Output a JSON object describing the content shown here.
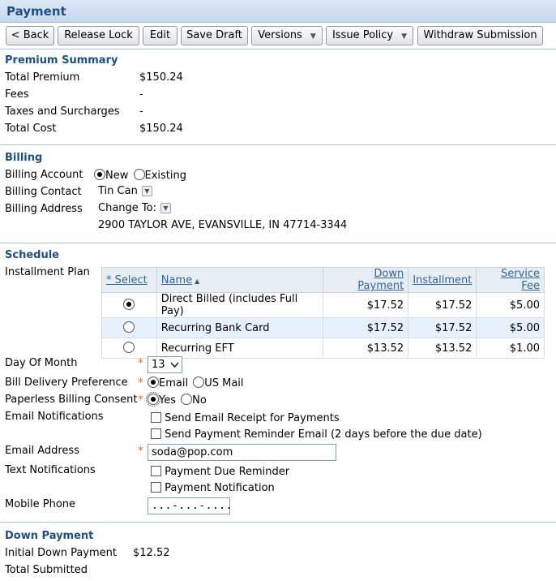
{
  "page": {
    "title": "Payment"
  },
  "toolbar": {
    "back": "< Back",
    "release_lock": "Release Lock",
    "edit": "Edit",
    "save_draft": "Save Draft",
    "versions": "Versions",
    "issue_policy": "Issue Policy",
    "withdraw": "Withdraw Submission",
    "caret": "▼"
  },
  "premium": {
    "heading": "Premium Summary",
    "rows": [
      {
        "label": "Total Premium",
        "value": "$150.24"
      },
      {
        "label": "Fees",
        "value": "-"
      },
      {
        "label": "Taxes and Surcharges",
        "value": "-"
      },
      {
        "label": "Total Cost",
        "value": "$150.24"
      }
    ]
  },
  "billing": {
    "heading": "Billing",
    "account_label": "Billing Account",
    "account_options": [
      "New",
      "Existing"
    ],
    "account_selected": "New",
    "contact_label": "Billing Contact",
    "contact_value": "Tin Can",
    "address_label": "Billing Address",
    "address_change": "Change To:",
    "address_value": "2900 TAYLOR AVE, EVANSVILLE, IN 47714-3344"
  },
  "schedule": {
    "heading": "Schedule",
    "installment_label": "Installment Plan",
    "columns": [
      "* Select",
      "Name",
      "Down Payment",
      "Installment",
      "Service Fee"
    ],
    "sort_indicator": "▲",
    "rows": [
      {
        "name": "Direct Billed (includes Full Pay)",
        "down": "$17.52",
        "installment": "$17.52",
        "fee": "$5.00",
        "selected": true
      },
      {
        "name": "Recurring Bank Card",
        "down": "$17.52",
        "installment": "$17.52",
        "fee": "$5.00",
        "selected": false
      },
      {
        "name": "Recurring EFT",
        "down": "$13.52",
        "installment": "$13.52",
        "fee": "$1.00",
        "selected": false
      }
    ],
    "day_label": "Day Of Month",
    "day_value": "13",
    "delivery_label": "Bill Delivery Preference",
    "delivery_options": [
      "Email",
      "US Mail"
    ],
    "paperless_label": "Paperless Billing Consent",
    "paperless_options": [
      "Yes",
      "No"
    ],
    "email_notif_label": "Email Notifications",
    "email_notif_options": [
      "Send Email Receipt for Payments",
      "Send Payment Reminder Email (2 days before the due date)"
    ],
    "email_label": "Email Address",
    "email_value": "soda@pop.com",
    "text_notif_label": "Text Notifications",
    "text_notif_options": [
      "Payment Due Reminder",
      "Payment Notification"
    ],
    "mobile_label": "Mobile Phone",
    "mobile_value": "...-...-...."
  },
  "down_payment": {
    "heading": "Down Payment",
    "initial_label": "Initial Down Payment",
    "initial_value": "$12.52",
    "submitted_label": "Total Submitted"
  },
  "required_mark": "*"
}
